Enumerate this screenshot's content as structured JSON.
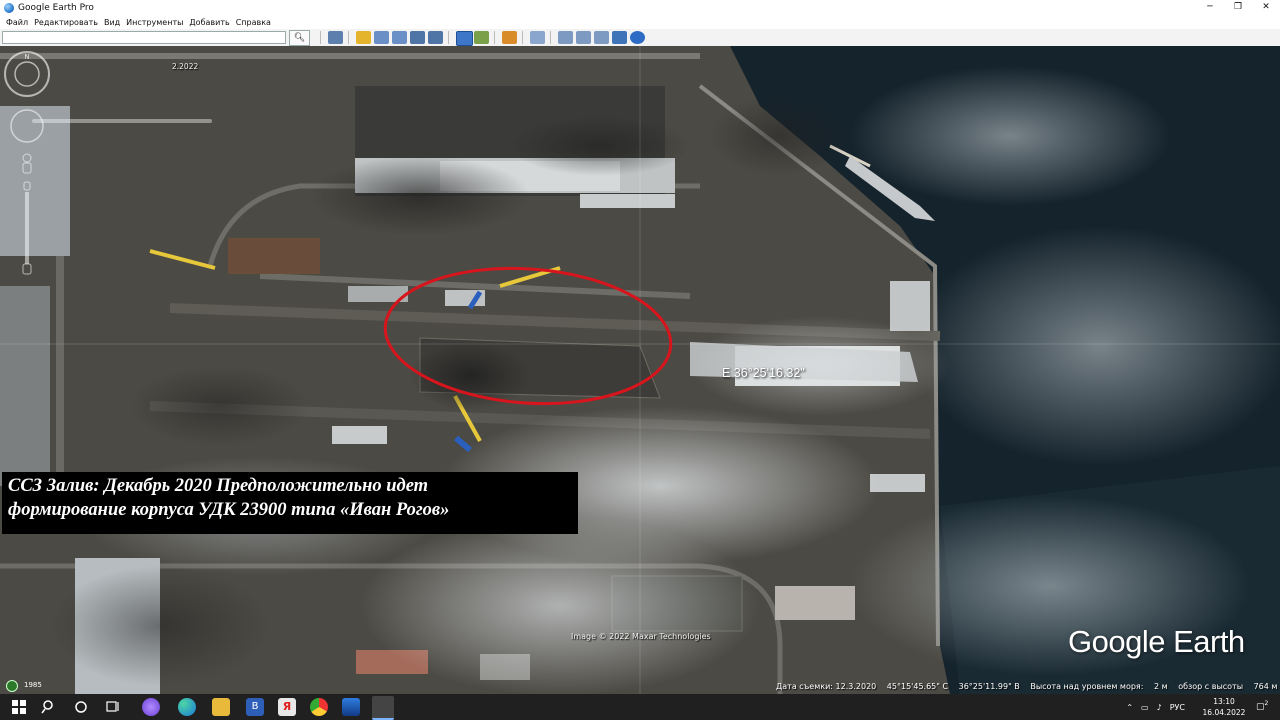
{
  "window": {
    "title": "Google Earth Pro",
    "minimize": "─",
    "maximize": "❐",
    "close": "✕"
  },
  "menu": [
    "Файл",
    "Редактировать",
    "Вид",
    "Инструменты",
    "Добавить",
    "Справка"
  ],
  "search": {
    "value": "",
    "placeholder": ""
  },
  "map": {
    "caption_line1": "ССЗ Залив: Декабрь 2020 Предположительно идет",
    "caption_line2": "формирование корпуса УДК 23900 типа «Иван Рогов»",
    "coordinate_label": "E 36°25'16.32\"",
    "imagery_credit": "Image © 2022 Maxar Technologies",
    "logo": "Google Earth",
    "time_slider_label": "2.2022",
    "historical_year": "1985",
    "highlight_color": "#d8141c"
  },
  "status_bar": {
    "capture_date": "Дата съемки: 12.3.2020",
    "latitude": "45°15'45.65\" С",
    "longitude": "36°25'11.99\" В",
    "elevation": "Высота над уровнем моря:",
    "elevation_value": "2 м",
    "eye_alt": "обзор с высоты",
    "eye_alt_value": "764 м"
  },
  "taskbar": {
    "language": "РУС",
    "time": "13:10",
    "date": "16.04.2022",
    "notification_count": "2"
  }
}
